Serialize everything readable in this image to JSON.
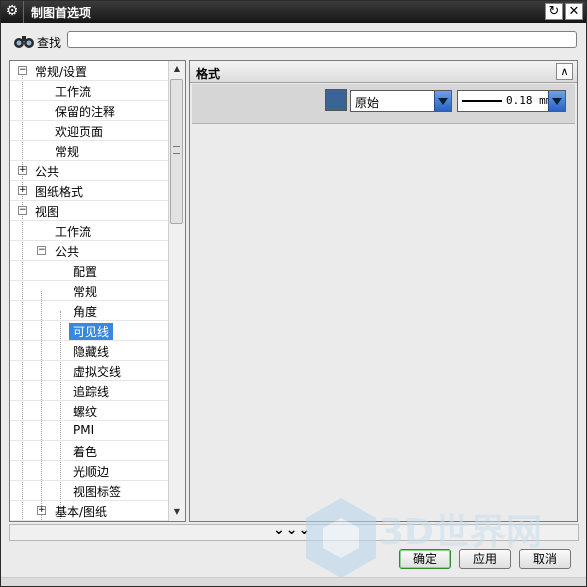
{
  "window": {
    "title": "制图首选项"
  },
  "search": {
    "label": "查找",
    "value": ""
  },
  "tree": {
    "items": [
      {
        "label": "常规/设置",
        "level": 0,
        "expander": "⊟"
      },
      {
        "label": "工作流",
        "level": 1
      },
      {
        "label": "保留的注释",
        "level": 1
      },
      {
        "label": "欢迎页面",
        "level": 1
      },
      {
        "label": "常规",
        "level": 1
      },
      {
        "label": "公共",
        "level": 0,
        "expander": "⊞"
      },
      {
        "label": "图纸格式",
        "level": 0,
        "expander": "⊞"
      },
      {
        "label": "视图",
        "level": 0,
        "expander": "⊟"
      },
      {
        "label": "工作流",
        "level": 1
      },
      {
        "label": "公共",
        "level": 1,
        "expander": "⊟"
      },
      {
        "label": "配置",
        "level": 2
      },
      {
        "label": "常规",
        "level": 2
      },
      {
        "label": "角度",
        "level": 2
      },
      {
        "label": "可见线",
        "level": 2,
        "selected": true
      },
      {
        "label": "隐藏线",
        "level": 2
      },
      {
        "label": "虚拟交线",
        "level": 2
      },
      {
        "label": "追踪线",
        "level": 2
      },
      {
        "label": "螺纹",
        "level": 2
      },
      {
        "label": "PMI",
        "level": 2
      },
      {
        "label": "着色",
        "level": 2
      },
      {
        "label": "光顺边",
        "level": 2
      },
      {
        "label": "视图标签",
        "level": 2
      },
      {
        "label": "基本/图纸",
        "level": 1,
        "expander": "⊞"
      }
    ]
  },
  "panel": {
    "header": "格式",
    "color_swatch": "#3a6496",
    "color_font": "原始",
    "line_width": "0.18 mm"
  },
  "buttons": {
    "ok": "确定",
    "apply": "应用",
    "cancel": "取消"
  },
  "watermark": {
    "text": "3D世界网"
  },
  "colors": {
    "title_bar": "#1c1c1c",
    "selection": "#3a87e0",
    "dropdown_arrow": "#2a62c2"
  }
}
